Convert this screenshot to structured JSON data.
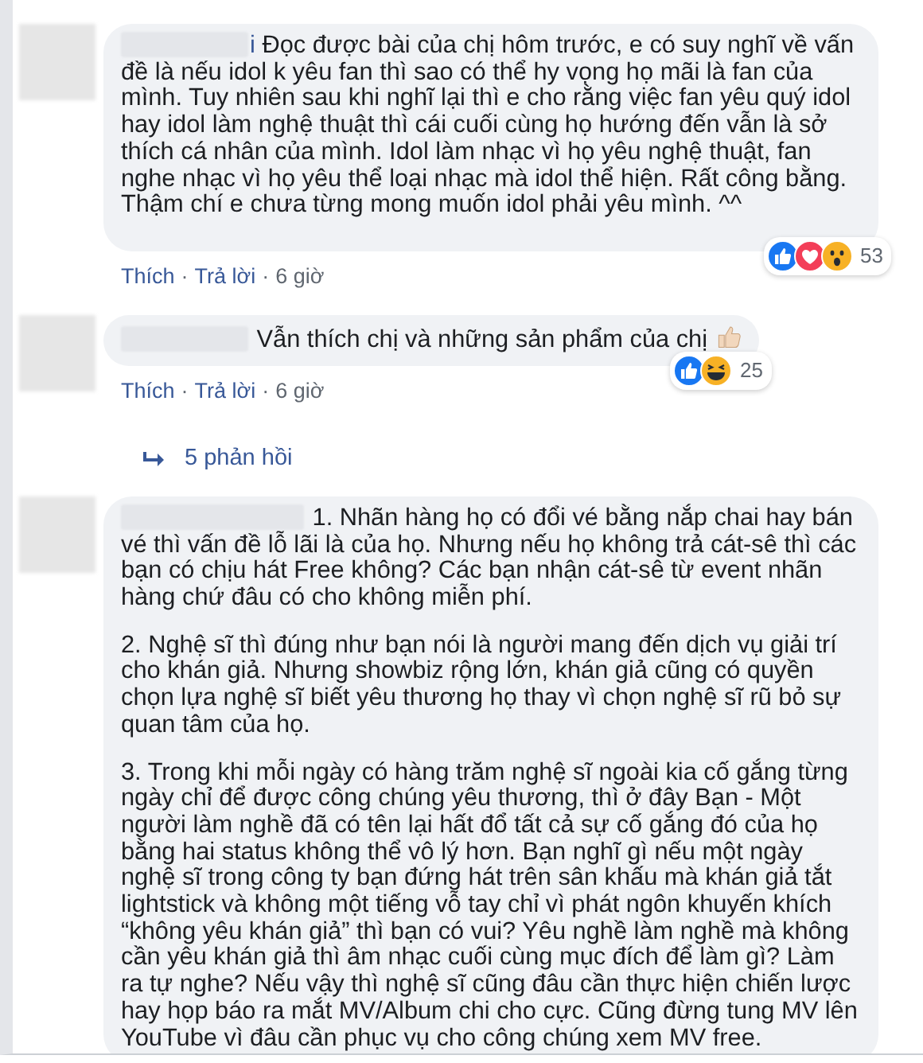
{
  "comments": [
    {
      "name_fragment": "i",
      "paragraphs": [
        "Đọc được bài của chị hôm trước, e có suy nghĩ về vấn đề là nếu idol k yêu fan thì sao có thể hy vọng họ mãi là fan của mình. Tuy nhiên sau khi nghĩ lại thì e cho rằng việc fan yêu quý idol hay idol làm nghệ thuật thì cái cuối cùng họ hướng đến vẫn là sở thích cá nhân của mình. Idol làm nhạc vì họ yêu nghệ thuật, fan nghe nhạc vì họ yêu thể loại nhạc mà idol thể hiện. Rất công bằng. Thậm chí e chưa từng mong muốn idol phải yêu mình. ^^"
      ],
      "ends_with_thumb": false,
      "like": "Thích",
      "separator_1": "·",
      "reply": "Trả lời",
      "separator_2": "·",
      "time": "6 giờ",
      "reactions": [
        {
          "kind": "like"
        },
        {
          "kind": "love"
        },
        {
          "kind": "wow"
        }
      ],
      "reaction_count": "53"
    },
    {
      "paragraphs": [
        "Vẫn thích chị và những sản phẩm của chị"
      ],
      "ends_with_thumb": true,
      "like": "Thích",
      "separator_1": "·",
      "reply": "Trả lời",
      "separator_2": "·",
      "time": "6 giờ",
      "reactions": [
        {
          "kind": "like"
        },
        {
          "kind": "haha"
        }
      ],
      "reaction_count": "25",
      "replies_link": "5 phản hồi"
    },
    {
      "paragraphs": [
        "1. Nhãn hàng họ có đổi vé bằng nắp chai hay bán vé thì vấn đề lỗ lãi là của họ. Nhưng nếu họ không trả cát-sê thì các bạn có chịu hát Free không? Các bạn nhận cát-sê từ event nhãn hàng chứ đâu có cho không miễn phí.",
        "2. Nghệ sĩ thì đúng như bạn nói là người mang đến dịch vụ giải trí cho khán giả. Nhưng showbiz rộng lớn, khán giả cũng có quyền chọn lựa nghệ sĩ biết yêu thương họ thay vì chọn nghệ sĩ rũ bỏ sự quan tâm của họ.",
        "3. Trong khi mỗi ngày có hàng trăm nghệ sĩ ngoài kia cố gắng từng ngày chỉ để được công chúng yêu thương, thì ở đây Bạn - Một người làm nghề đã có tên lại hất đổ tất cả sự cố gắng đó của họ bằng hai status không thể vô lý hơn. Bạn nghĩ gì nếu một ngày nghệ sĩ trong công ty bạn đứng hát trên sân khấu mà khán giả tắt lightstick và không một tiếng vỗ tay chỉ vì phát ngôn khuyến khích “không yêu khán giả” thì bạn có vui? Yêu nghề làm nghề mà không cần yêu khán giả thì âm nhạc cuối cùng mục đích để làm gì? Làm ra tự nghe? Nếu vậy thì nghệ sĩ cũng đâu cần thực hiện chiến lược hay họp báo ra mắt MV/Album chi cho cực. Cũng đừng tung MV lên YouTube vì đâu cần phục vụ cho công chúng xem MV free."
      ],
      "ends_with_thumb": false
    }
  ]
}
